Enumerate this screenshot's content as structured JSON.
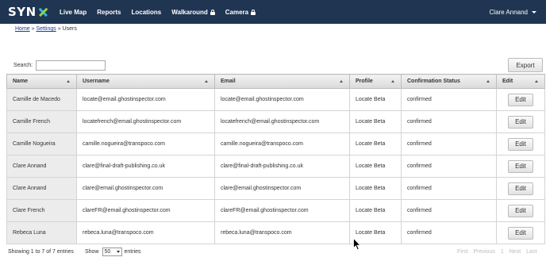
{
  "brand": {
    "logo_text": "SYN"
  },
  "nav": {
    "items": [
      {
        "label": "Live Map",
        "locked": false
      },
      {
        "label": "Reports",
        "locked": false
      },
      {
        "label": "Locations",
        "locked": false
      },
      {
        "label": "Walkaround",
        "locked": true
      },
      {
        "label": "Camera",
        "locked": true
      }
    ],
    "user": "Clare Annand"
  },
  "breadcrumb": {
    "home": "Home",
    "sep1": " » ",
    "settings": "Settings",
    "sep2": " » ",
    "current": "Users"
  },
  "search": {
    "label": "Search:",
    "value": ""
  },
  "export_label": "Export",
  "table": {
    "headers": [
      "Name",
      "Username",
      "Email",
      "Profile",
      "Confirmation Status",
      "Edit"
    ],
    "rows": [
      [
        "Camille de Macedo",
        "locate@email.ghostinspector.com",
        "locate@email.ghostinspector.com",
        "Locate Beta",
        "confirmed"
      ],
      [
        "Camille French",
        "locatefrench@email.ghostinspector.com",
        "locatefrench@email.ghostinspector.com",
        "Locate Beta",
        "confirmed"
      ],
      [
        "Camille Nogueira",
        "camille.nogueira@transpoco.com",
        "camille.nogueira@transpoco.com",
        "Locate Beta",
        "confirmed"
      ],
      [
        "Clare Annand",
        "clare@final-draft-publishing.co.uk",
        "clare@final-draft-publishing.co.uk",
        "Locate Beta",
        "confirmed"
      ],
      [
        "Clare Annand",
        "clare@email.ghostinspector.com",
        "clare@email.ghostinspector.com",
        "Locate Beta",
        "confirmed"
      ],
      [
        "Clare French",
        "clareFR@email.ghostinspector.com",
        "clareFR@email.ghostinspector.com",
        "Locate Beta",
        "confirmed"
      ],
      [
        "Rebeca Luna",
        "rebeca.luna@transpoco.com",
        "rebeca.luna@transpoco.com",
        "Locate Beta",
        "confirmed"
      ]
    ],
    "edit_label": "Edit"
  },
  "footer": {
    "info": "Showing 1 to 7 of 7 entries",
    "show_label": "Show",
    "page_size": "50",
    "entries_label": "entries",
    "pager": [
      "First",
      "Previous",
      "1",
      "Next",
      "Last"
    ]
  }
}
